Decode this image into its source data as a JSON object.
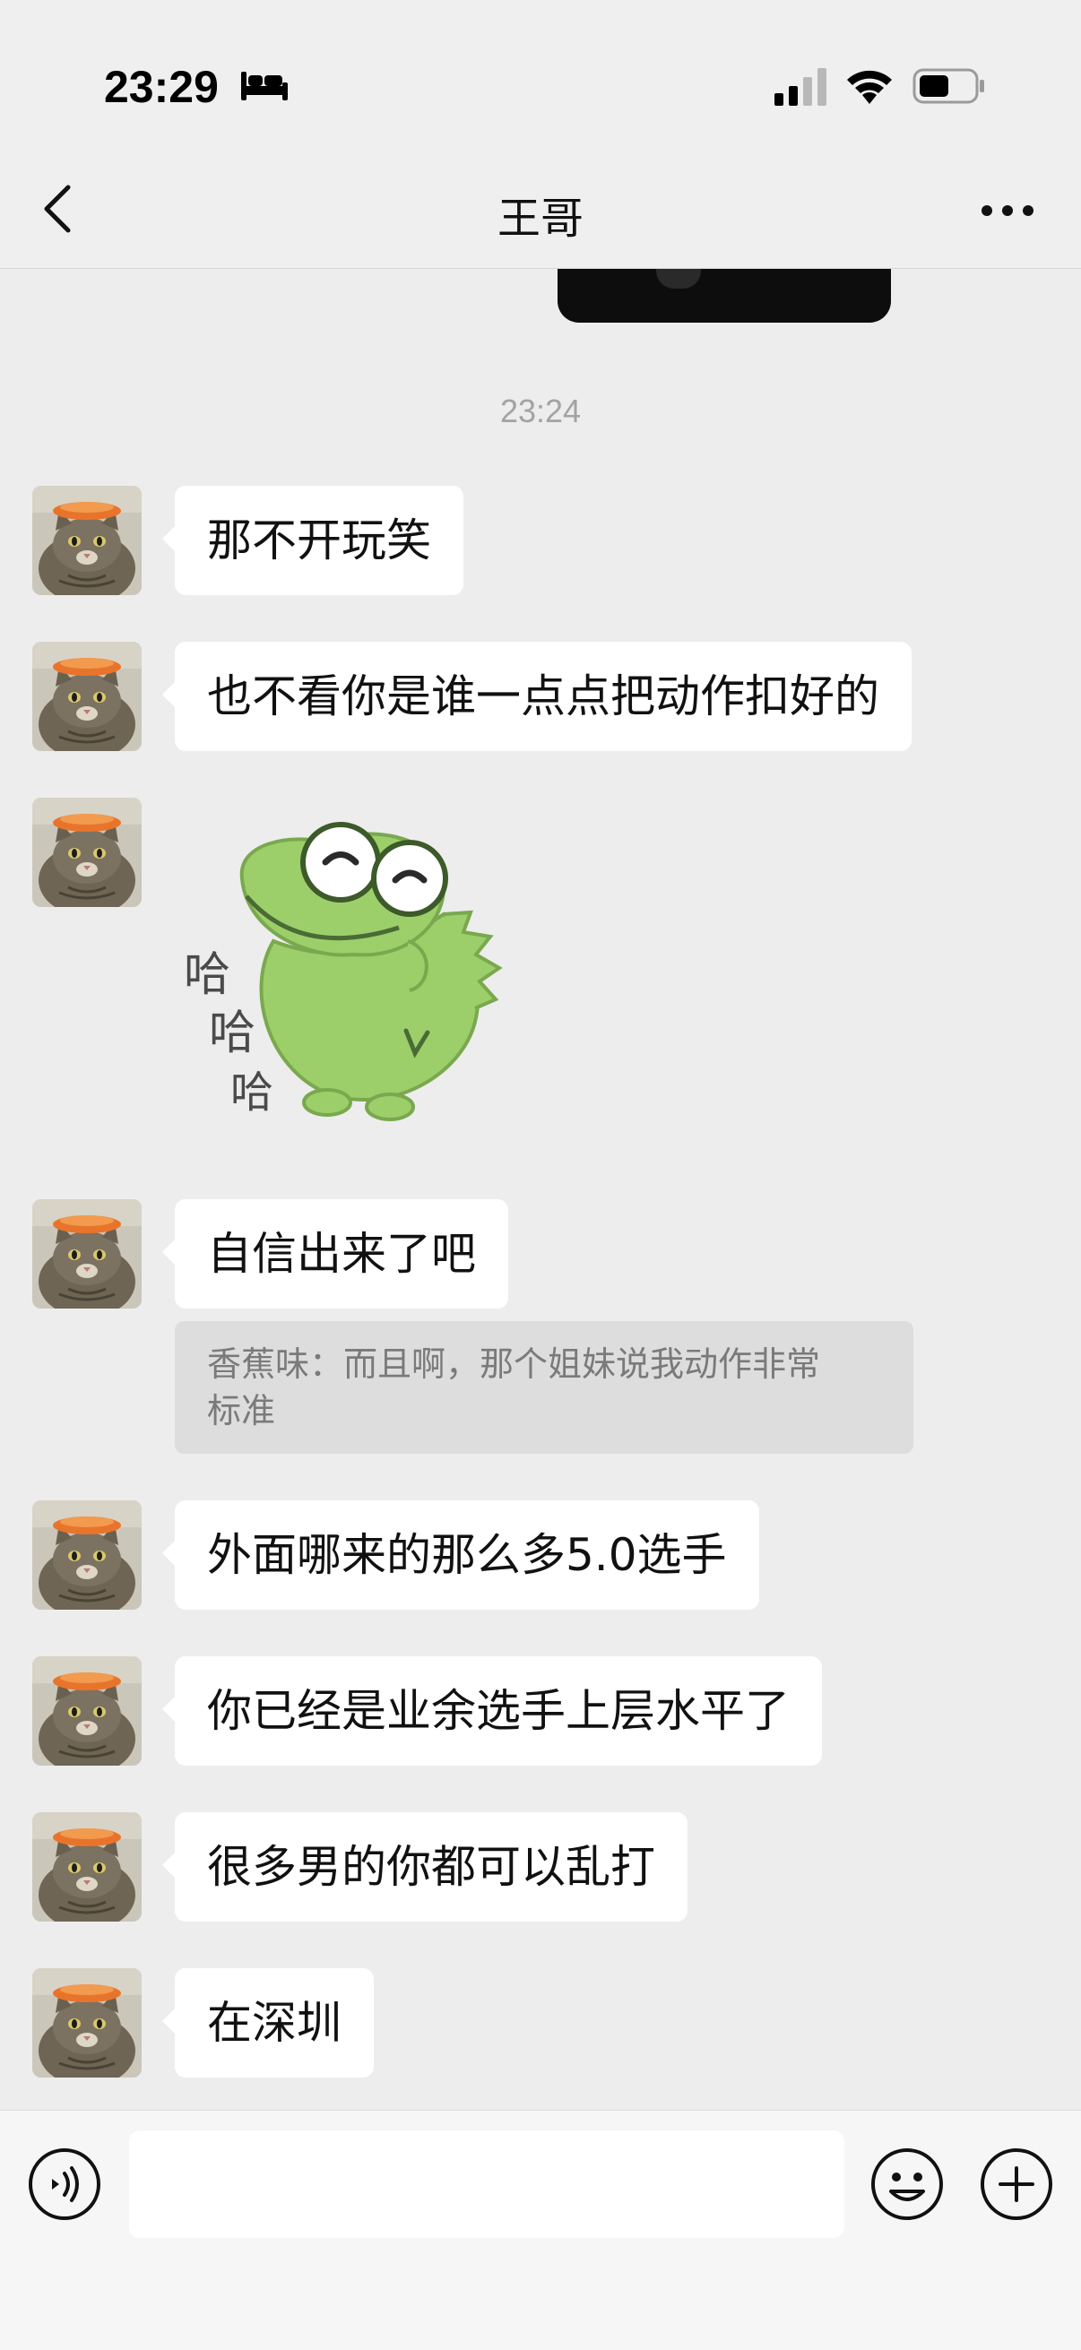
{
  "status_bar": {
    "time": "23:29",
    "battery_level": 0.55,
    "signal_bars": 2
  },
  "header": {
    "title": "王哥"
  },
  "timestamp": "23:24",
  "messages": [
    {
      "text": "那不开玩笑"
    },
    {
      "text": "也不看你是谁一点点把动作扣好的"
    },
    {
      "sticker": "crocodile-laughing-sticker",
      "sticker_text": [
        "哈",
        "哈",
        "哈"
      ]
    },
    {
      "text": "自信出来了吧",
      "quote": "香蕉味：而且啊，那个姐妹说我动作非常标准"
    },
    {
      "text": "外面哪来的那么多5.0选手"
    },
    {
      "text": "你已经是业余选手上层水平了"
    },
    {
      "text": "很多男的你都可以乱打"
    },
    {
      "text": "在深圳"
    }
  ],
  "quote_lines": [
    "香蕉味：而且啊，那个姐妹说我动作非常",
    "标准"
  ],
  "input": {
    "value": ""
  },
  "colors": {
    "background": "#ededed",
    "bubble": "#ffffff",
    "sticker_green": "#9ccf6a",
    "quote_bg": "#dddddd"
  }
}
